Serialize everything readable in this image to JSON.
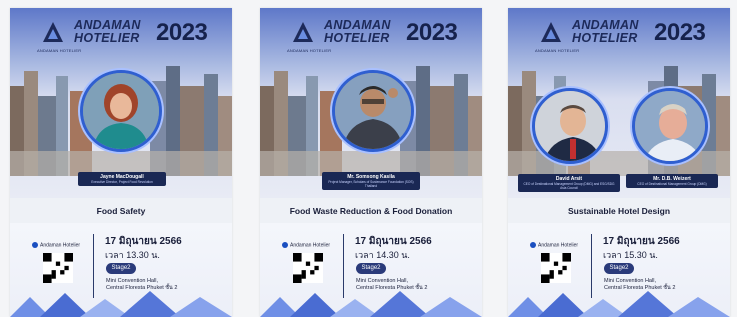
{
  "brand": {
    "line1": "ANDAMAN",
    "line2": "HOTELIER",
    "year": "2023",
    "logo_sub": "ANDAMAN HOTELIER"
  },
  "posters": [
    {
      "speakers": [
        {
          "name": "Jayne MacDougall",
          "role": "Executive Director, Project Food Revolution"
        }
      ],
      "topic": "Food Safety",
      "facebook": "Andaman Hotelier",
      "date": "17 มิถุนายน 2566",
      "time": "เวลา 13.30 น.",
      "stage": "Stage2",
      "venue_line1": "Mini Convention Hall,",
      "venue_line2": "Central Floresta Phuket ชั้น 2"
    },
    {
      "speakers": [
        {
          "name": "Mr. Somsong Kasila",
          "role": "Project Manager, Scholars of Sustenance Foundation (SOS) Thailand"
        }
      ],
      "topic": "Food Waste Reduction & Food Donation",
      "facebook": "Andaman Hotelier",
      "date": "17 มิถุนายน 2566",
      "time": "เวลา 14.30 น.",
      "stage": "Stage2",
      "venue_line1": "Mini Convention Hall,",
      "venue_line2": "Central Floresta Phuket ชั้น 2"
    },
    {
      "speakers": [
        {
          "name": "David Arsit",
          "role": "CEO of Destinational Management Group (DMG) and ESG/SDG Asia Council"
        },
        {
          "name": "Mr. D.B. Weizert",
          "role": "CEO of Destinational Management Group (DMG)"
        }
      ],
      "topic": "Sustainable Hotel Design",
      "facebook": "Andaman Hotelier",
      "date": "17 มิถุนายน 2566",
      "time": "เวลา 15.30 น.",
      "stage": "Stage2",
      "venue_line1": "Mini Convention Hall,",
      "venue_line2": "Central Floresta Phuket ชั้น 2"
    }
  ],
  "colors": {
    "navy": "#1a2854",
    "ring": "#2f5fd0",
    "accent": "#1a4fc0"
  }
}
